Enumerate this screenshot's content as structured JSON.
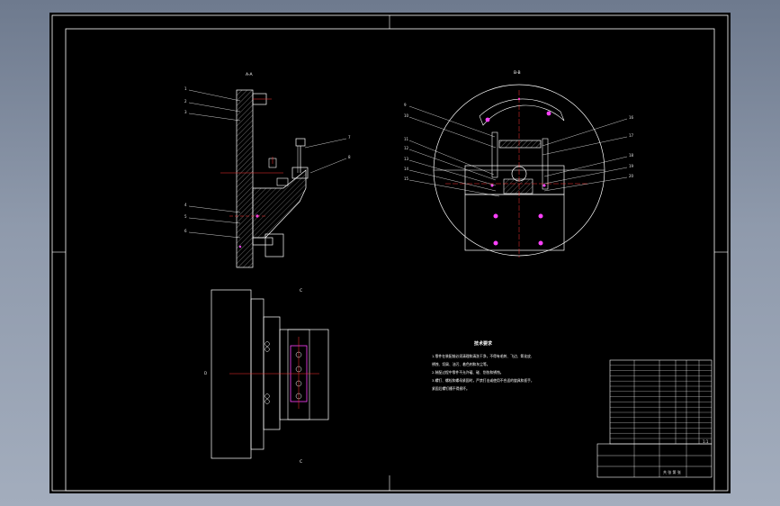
{
  "sheet": {
    "view_labels": {
      "section_aa": "A-A",
      "section_bb": "B-B",
      "view_c_top": "C",
      "view_c_bottom": "C",
      "dim_left": "D"
    },
    "callouts_left": [
      "1",
      "2",
      "3",
      "4",
      "5",
      "6",
      "7",
      "8"
    ],
    "callouts_right": [
      "9",
      "10",
      "11",
      "12",
      "13",
      "14",
      "15",
      "16",
      "17",
      "18",
      "19",
      "20"
    ],
    "tech_notes": {
      "title": "技术要求",
      "lines": [
        "1.零件在装配前必须清理和清洗干净，不得有毛刺、飞边、氧化皮、",
        "锈蚀、切屑、油污、着色剂和灰尘等。",
        "2.装配过程中零件不允许磕、碰、划伤和锈蚀。",
        "3.螺钉、螺栓和螺母紧固时，严禁打击或使用不合适的旋具和扳手，",
        "紧固后螺钉槽不得损坏。"
      ]
    },
    "title_block": {
      "scale": "1:1",
      "sheet_label": "共 张 第 张"
    }
  },
  "colors": {
    "background": "#000000",
    "frame": "#ffffff",
    "centerline": "#ff3030",
    "highlight": "#ff40ff",
    "leader": "#ffffff"
  }
}
